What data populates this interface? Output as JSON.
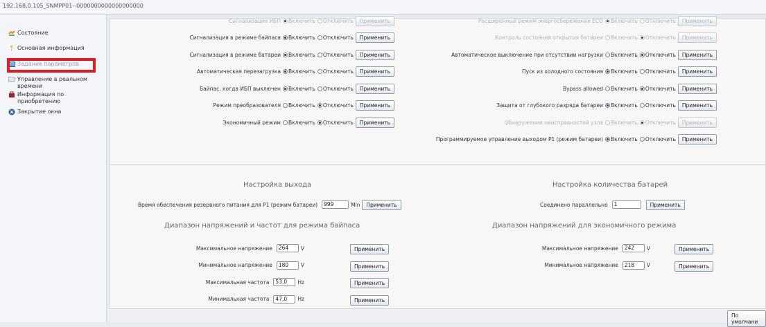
{
  "window": {
    "title": "192.168.0.105_SNMPP01--0000000000000000000"
  },
  "sidebar": {
    "items": [
      {
        "label": "Состояние",
        "icon": "status-icon"
      },
      {
        "label": "Основная информация",
        "icon": "info-icon"
      },
      {
        "label": "Задание параметров",
        "icon": "settings-icon"
      },
      {
        "label": "Управление в реальном времени",
        "icon": "realtime-icon"
      },
      {
        "label": "Информация по приобретению",
        "icon": "purchase-icon"
      },
      {
        "label": "Закрытие окна",
        "icon": "close-window-icon"
      }
    ]
  },
  "common": {
    "enable": "Включить",
    "disable": "Отключить",
    "apply": "Применить"
  },
  "left_settings": [
    {
      "label": "Сигнализация ИБП",
      "state": "enable",
      "disabled": true
    },
    {
      "label": "Сигнализация в режиме байпаса",
      "state": "enable",
      "disabled": false
    },
    {
      "label": "Сигнализация в режиме батареи",
      "state": "enable",
      "disabled": false
    },
    {
      "label": "Автоматическая перезагрузка",
      "state": "enable",
      "disabled": false
    },
    {
      "label": "Байпас, когда ИБП выключен",
      "state": "enable",
      "disabled": false
    },
    {
      "label": "Режим преобразователя",
      "state": "disable",
      "disabled": false
    },
    {
      "label": "Экономичный режим",
      "state": "disable",
      "disabled": false
    }
  ],
  "right_settings": [
    {
      "label": "Расширенный режим энергосбережения ECO",
      "state": "enable",
      "disabled": true
    },
    {
      "label": "Контроль состояния открытия батареи",
      "state": "disable",
      "disabled": true
    },
    {
      "label": "Автоматическое выключение при отсутствии нагрузки",
      "state": "disable",
      "disabled": false
    },
    {
      "label": "Пуск из холодного состояния",
      "state": "enable",
      "disabled": false
    },
    {
      "label": "Bypass allowed",
      "state": "disable",
      "disabled": false
    },
    {
      "label": "Защита от глубокого разряда батареи",
      "state": "enable",
      "disabled": false
    },
    {
      "label": "Обнаружение неисправностей узла",
      "state": "disable",
      "disabled": true
    },
    {
      "label": "Программируемое управление выходом P1 (режим батареи)",
      "state": "enable",
      "disabled": false
    }
  ],
  "output": {
    "title": "Настройка выхода",
    "label": "Время обеспечения резервного питания для P1 (режим батареи)",
    "value": "999",
    "unit": "Min"
  },
  "battery": {
    "title": "Настройка количества батарей",
    "label": "Соединено параллельно",
    "value": "1"
  },
  "bypass": {
    "title": "Диапазон напряжений и частот для режима байпаса",
    "rows": [
      {
        "label": "Максимальное напряжение",
        "value": "264",
        "unit": "V"
      },
      {
        "label": "Минимальное напряжение",
        "value": "180",
        "unit": "V"
      },
      {
        "label": "Максимальная частота",
        "value": "53,0",
        "unit": "Hz"
      },
      {
        "label": "Минимальная частота",
        "value": "47,0",
        "unit": "Hz"
      }
    ]
  },
  "eco": {
    "title": "Диапазон напряжений для экономичного режима",
    "rows": [
      {
        "label": "Максимальное напряжение",
        "value": "242",
        "unit": "V"
      },
      {
        "label": "Минимальное напряжение",
        "value": "218",
        "unit": "V"
      }
    ]
  },
  "footer": {
    "default_label": "По умолчани"
  },
  "colors": {
    "highlight": "#e11b22"
  }
}
